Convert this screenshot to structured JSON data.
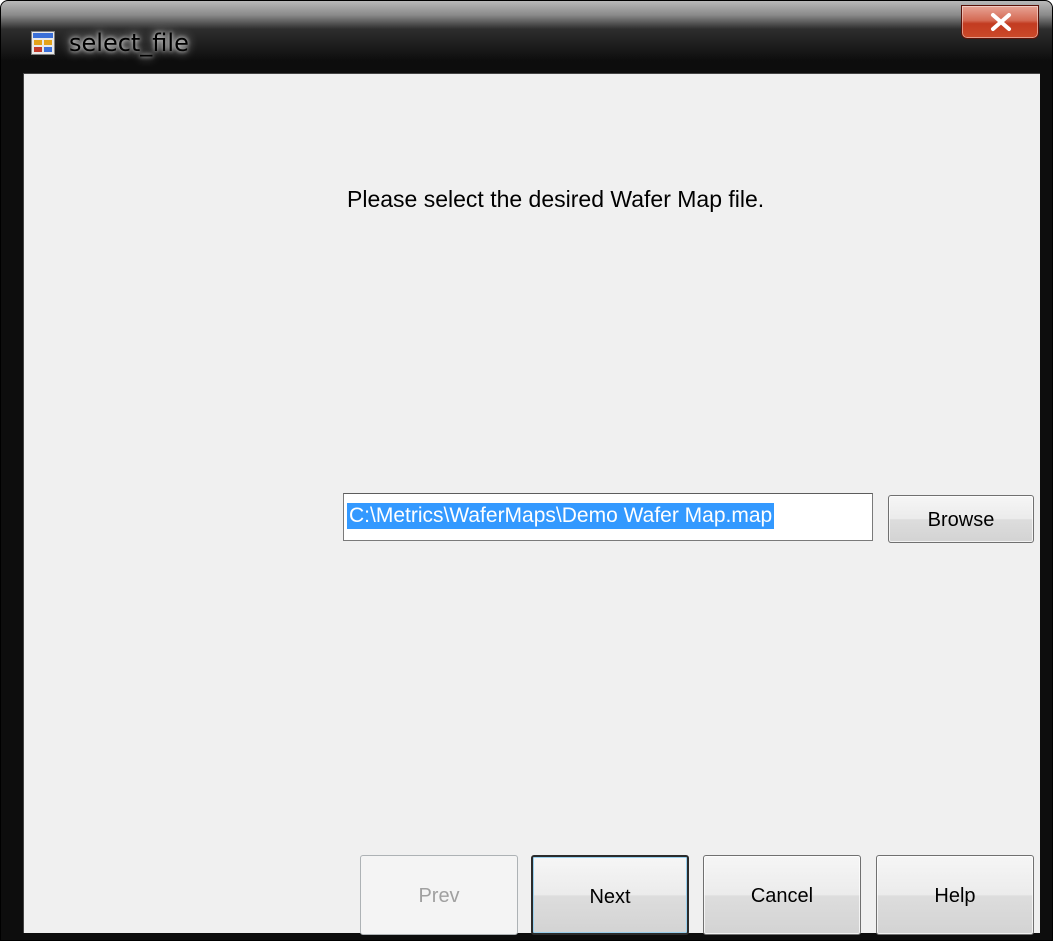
{
  "window": {
    "title": "select_file",
    "title_icon": "app-form-icon",
    "close_icon": "close-icon"
  },
  "main": {
    "prompt": "Please select the desired Wafer Map file.",
    "file_path": "C:\\Metrics\\WaferMaps\\Demo Wafer Map.map",
    "browse_label": "Browse"
  },
  "footer": {
    "prev_label": "Prev",
    "next_label": "Next",
    "cancel_label": "Cancel",
    "help_label": "Help"
  },
  "colors": {
    "selection": "#3399ff",
    "close_button": "#c23b20",
    "dialog_background": "#f0f0f0"
  }
}
